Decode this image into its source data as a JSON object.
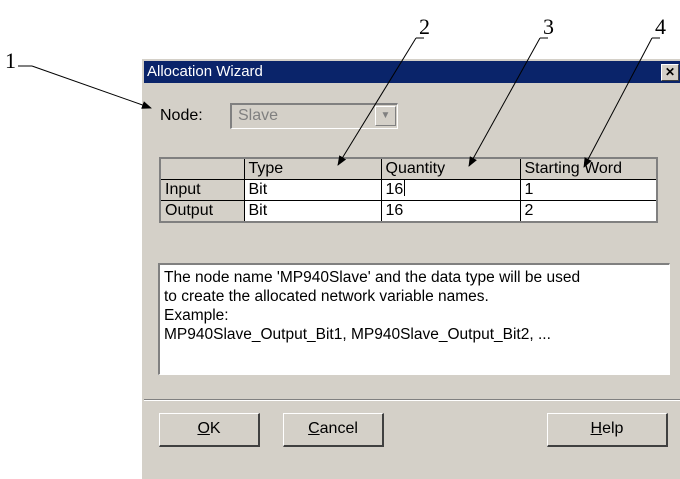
{
  "callouts": [
    "1",
    "2",
    "3",
    "4"
  ],
  "dialog": {
    "title": "Allocation Wizard",
    "close_glyph": "✕",
    "node": {
      "label": "Node:",
      "value": "Slave",
      "arrow_glyph": "▼"
    },
    "grid": {
      "columns": [
        "",
        "Type",
        "Quantity",
        "Starting Word"
      ],
      "rows": [
        {
          "label": "Input",
          "type": "Bit",
          "quantity": "16",
          "starting_word": "1"
        },
        {
          "label": "Output",
          "type": "Bit",
          "quantity": "16",
          "starting_word": "2"
        }
      ]
    },
    "info_lines": [
      "The node name 'MP940Slave' and the data type will be used",
      "to create the allocated network variable names.",
      "Example:",
      "MP940Slave_Output_Bit1, MP940Slave_Output_Bit2, ..."
    ],
    "buttons": {
      "ok": {
        "accel": "O",
        "rest": "K"
      },
      "cancel": {
        "accel": "C",
        "rest": "ancel"
      },
      "help": {
        "accel": "H",
        "rest": "elp"
      }
    }
  }
}
